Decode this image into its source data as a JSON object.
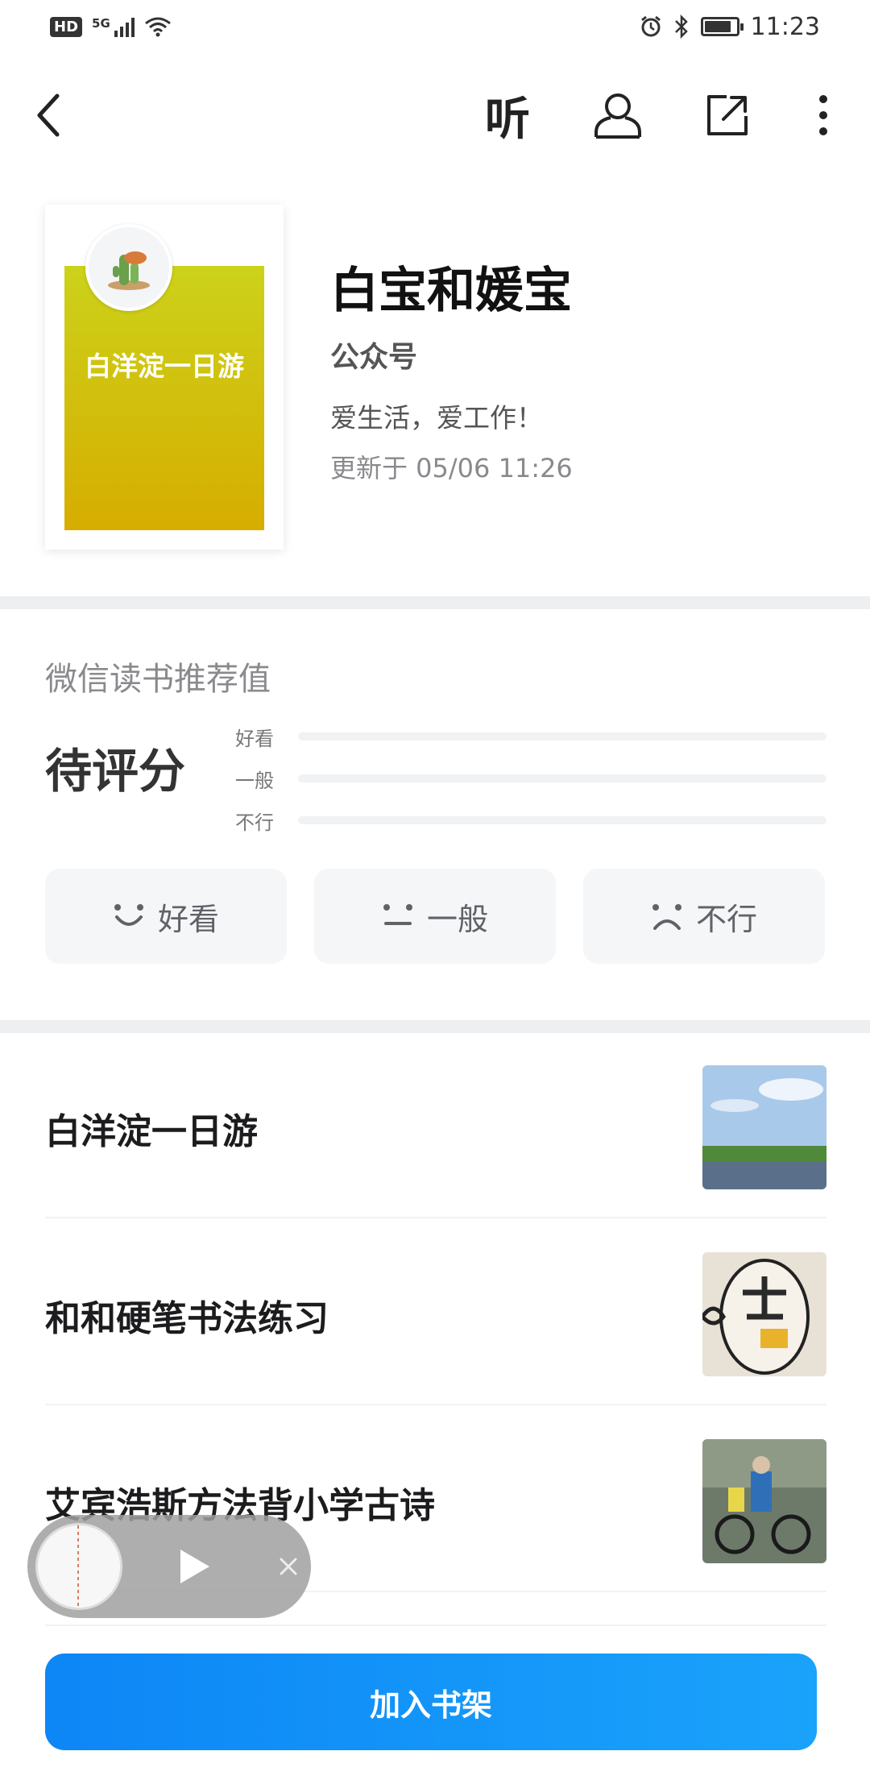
{
  "status_bar": {
    "hd": "HD",
    "network": "5G",
    "time": "11:23",
    "battery_level": 0.85
  },
  "nav": {
    "listen_label": "听"
  },
  "book": {
    "cover_title": "白洋淀一日游",
    "title": "白宝和媛宝",
    "type": "公众号",
    "description": "爱生活，爱工作！",
    "updated": "更新于 05/06 11:26"
  },
  "rating": {
    "title": "微信读书推荐值",
    "status": "待评分",
    "rows": [
      {
        "label": "好看",
        "fraction": 0
      },
      {
        "label": "一般",
        "fraction": 0
      },
      {
        "label": "不行",
        "fraction": 0
      }
    ],
    "buttons": {
      "good": "好看",
      "ok": "一般",
      "bad": "不行"
    }
  },
  "articles": [
    {
      "title": "白洋淀一日游"
    },
    {
      "title": "和和硬笔书法练习"
    },
    {
      "title": "艾宾浩斯方法背小学古诗"
    }
  ],
  "bottom": {
    "add_shelf": "加入书架"
  },
  "colors": {
    "accent": "#1b88ee",
    "button_gradient_start": "#0d86f6",
    "button_gradient_end": "#1aa3fb",
    "cover_top": "#ccd21a",
    "cover_bottom": "#d6ad00"
  }
}
